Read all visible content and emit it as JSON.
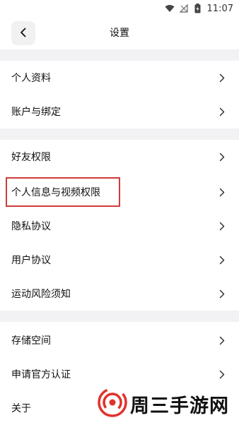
{
  "status_bar": {
    "time": "11:07",
    "icons": [
      "wifi-icon",
      "no-signal-icon",
      "battery-icon"
    ]
  },
  "header": {
    "back_icon": "chevron-left-icon",
    "title": "设置"
  },
  "sections": [
    {
      "items": [
        {
          "label": "个人资料"
        },
        {
          "label": "账户与绑定"
        }
      ]
    },
    {
      "items": [
        {
          "label": "好友权限"
        },
        {
          "label": "个人信息与视频权限",
          "highlighted": true
        },
        {
          "label": "隐私协议"
        },
        {
          "label": "用户协议"
        },
        {
          "label": "运动风险须知"
        }
      ]
    },
    {
      "items": [
        {
          "label": "存储空间"
        },
        {
          "label": "申请官方认证"
        },
        {
          "label": "关于"
        }
      ]
    }
  ],
  "colors": {
    "background": "#ffffff",
    "section_gap": "#f2f2f4",
    "highlight_border": "#cf3b3b",
    "watermark_red": "#e0322a"
  },
  "watermark": {
    "text": "周三手游网"
  }
}
